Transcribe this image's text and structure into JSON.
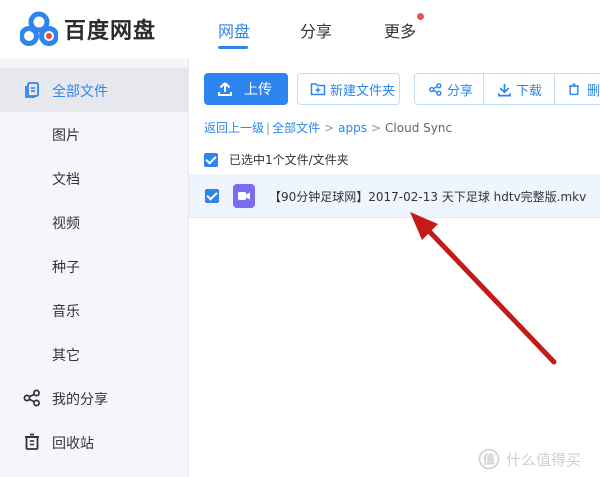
{
  "brand": {
    "name": "百度网盘",
    "icon": "baidu-cloud-logo"
  },
  "nav": {
    "tabs": [
      {
        "label": "网盘",
        "active": true
      },
      {
        "label": "分享",
        "active": false
      },
      {
        "label": "更多",
        "active": false,
        "has_badge": true
      }
    ]
  },
  "sidebar": {
    "items": [
      {
        "label": "全部文件",
        "icon": "files-icon",
        "active": true
      },
      {
        "label": "图片"
      },
      {
        "label": "文档"
      },
      {
        "label": "视频"
      },
      {
        "label": "种子"
      },
      {
        "label": "音乐"
      },
      {
        "label": "其它"
      },
      {
        "label": "我的分享",
        "icon": "share-icon"
      },
      {
        "label": "回收站",
        "icon": "trash-icon"
      }
    ]
  },
  "toolbar": {
    "upload_label": "上传",
    "new_folder_label": "新建文件夹",
    "share_label": "分享",
    "download_label": "下载",
    "delete_label": "删"
  },
  "breadcrumb": {
    "back_label": "返回上一级",
    "divider": "|",
    "all_files_label": "全部文件",
    "apps_label": "apps",
    "separator": ">",
    "current_label": "Cloud Sync"
  },
  "selection": {
    "text": "已选中1个文件/文件夹"
  },
  "file": {
    "name": "【90分钟足球网】2017-02-13 天下足球 hdtv完整版.mkv",
    "type_icon": "video-file-icon"
  },
  "watermark": {
    "text": "什么值得买"
  },
  "colors": {
    "accent": "#2f85f0",
    "video_icon": "#7b6cf0",
    "annotation_arrow": "#c41a1a"
  }
}
